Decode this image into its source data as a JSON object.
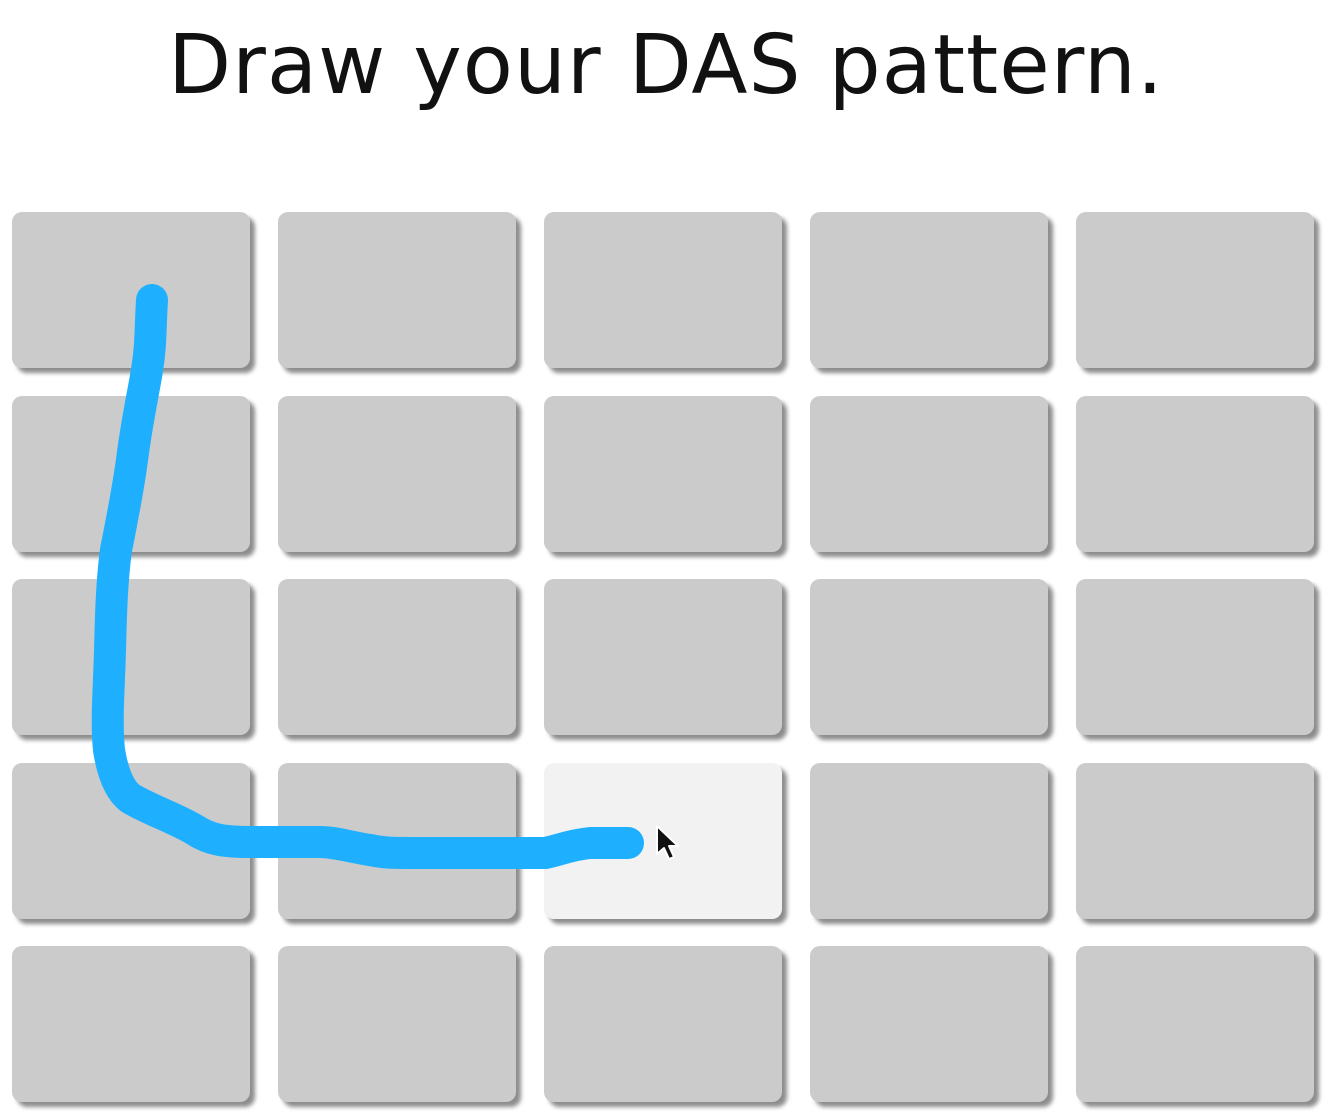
{
  "title": "Draw your DAS pattern.",
  "grid": {
    "rows": 5,
    "columns": 5,
    "cell_color": "#cbcbcb",
    "active_cell_color": "#f2f2f2",
    "active_cell": {
      "row": 4,
      "column": 3
    }
  },
  "pattern": {
    "stroke_color": "#1eb0ff",
    "visited_cells": [
      {
        "row": 1,
        "column": 1
      },
      {
        "row": 2,
        "column": 1
      },
      {
        "row": 3,
        "column": 1
      },
      {
        "row": 4,
        "column": 1
      },
      {
        "row": 4,
        "column": 2
      },
      {
        "row": 4,
        "column": 3
      }
    ]
  },
  "icons": {
    "cursor": "mouse-pointer-icon"
  }
}
